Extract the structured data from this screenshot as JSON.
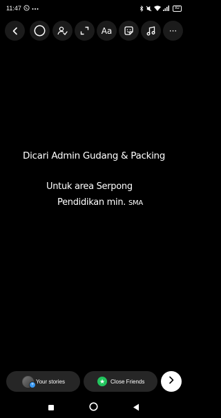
{
  "status_bar": {
    "time": "11:47",
    "battery": "82",
    "icons": [
      "whatsapp-icon",
      "more-dots-icon",
      "bluetooth-icon",
      "silent-icon",
      "wifi-icon",
      "signal-icon",
      "battery-icon"
    ]
  },
  "toolbar": {
    "text_tool_label": "Aa",
    "more_label": "···",
    "icons": [
      "back-icon",
      "circle-select-icon",
      "mention-icon",
      "expand-icon",
      "text-icon",
      "sticker-icon",
      "music-icon",
      "more-icon"
    ]
  },
  "story": {
    "line1": "Dicari Admin Gudang & Packing",
    "line2": "Untuk area Serpong",
    "line3_main": "Pendidikan min.",
    "line3_small": "SMA"
  },
  "share_bar": {
    "your_stories_label": "Your stories",
    "close_friends_label": "Close Friends",
    "accent_green": "#22c55e",
    "accent_blue": "#3897f0"
  },
  "nav_bar": {
    "icons": [
      "recents-icon",
      "home-icon",
      "back-triangle-icon"
    ]
  }
}
